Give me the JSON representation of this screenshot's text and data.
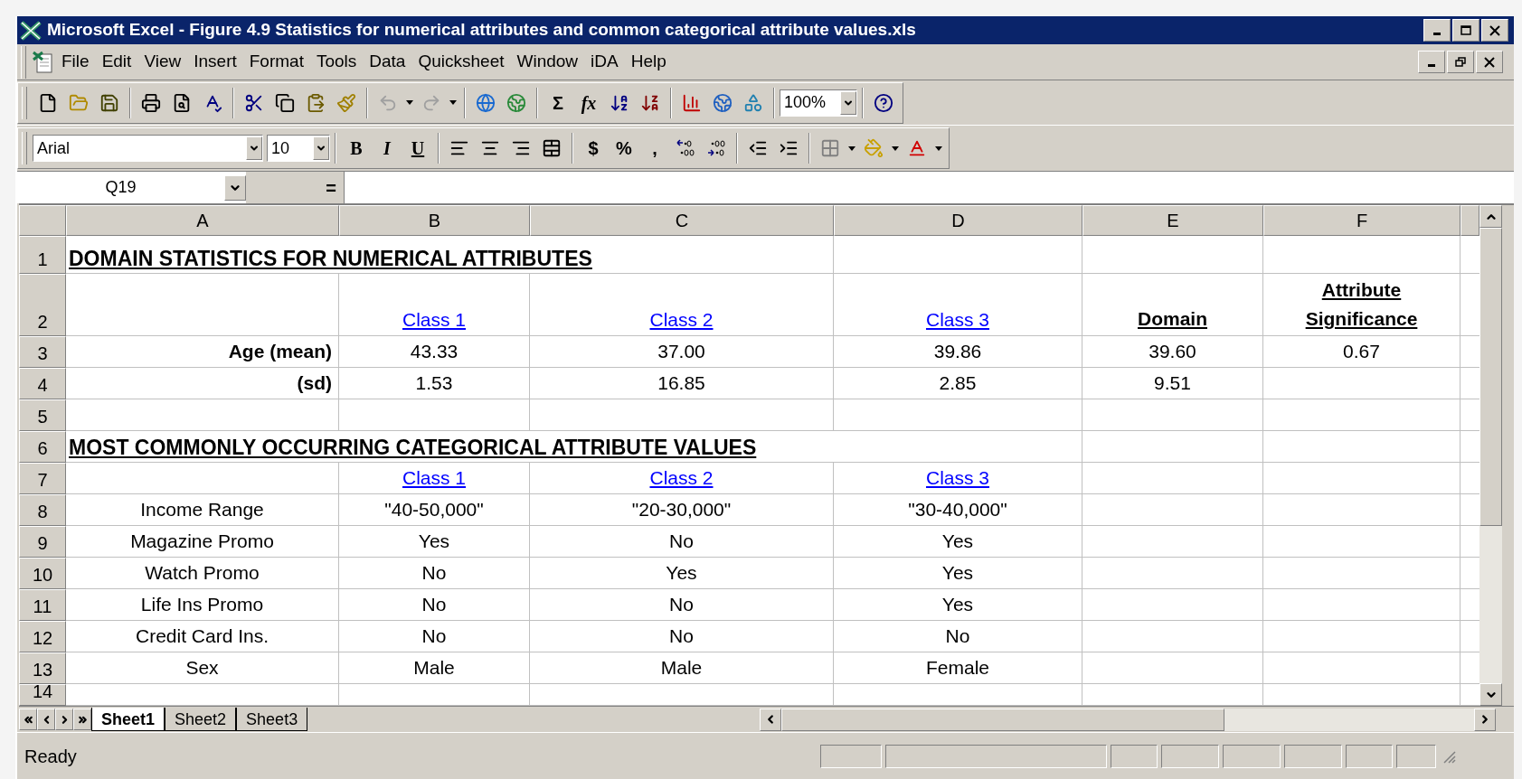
{
  "window": {
    "title": "Microsoft Excel - Figure 4.9 Statistics for numerical attributes and common categorical attribute values.xls"
  },
  "menu": [
    {
      "label": "File"
    },
    {
      "label": "Edit"
    },
    {
      "label": "View"
    },
    {
      "label": "Insert"
    },
    {
      "label": "Format"
    },
    {
      "label": "Tools"
    },
    {
      "label": "Data"
    },
    {
      "label": "Quicksheet"
    },
    {
      "label": "Window"
    },
    {
      "label": "iDA"
    },
    {
      "label": "Help"
    }
  ],
  "standard_toolbar": {
    "undo": {
      "disabled": true
    },
    "redo": {
      "disabled": true
    },
    "sum": "Σ",
    "function": "fx",
    "zoom": "100%"
  },
  "formatting_toolbar": {
    "font": "Arial",
    "size": "10",
    "bold": "B",
    "italic": "I",
    "underline": "U",
    "currency": "$",
    "percent": "%",
    "comma": ","
  },
  "formula_bar": {
    "name_box": "Q19",
    "equals": "="
  },
  "columns": [
    "A",
    "B",
    "C",
    "D",
    "E",
    "F"
  ],
  "rows": [
    {
      "number": "1",
      "cells": [
        {
          "kind": "heading",
          "text": "DOMAIN STATISTICS FOR NUMERICAL ATTRIBUTES"
        },
        {
          "kind": "blank"
        },
        {
          "kind": "blank"
        },
        {
          "kind": "blank"
        }
      ]
    },
    {
      "number": "2",
      "cells": [
        {
          "kind": "blank"
        },
        {
          "kind": "link",
          "text": "Class 1"
        },
        {
          "kind": "link",
          "text": "Class 2"
        },
        {
          "kind": "link",
          "text": "Class 3"
        },
        {
          "kind": "header",
          "text": "Domain"
        },
        {
          "kind": "header",
          "text": "Attribute Significance"
        }
      ]
    },
    {
      "number": "3",
      "cells": [
        {
          "kind": "label_right",
          "text": "Age (mean)"
        },
        {
          "kind": "value",
          "text": "43.33"
        },
        {
          "kind": "value",
          "text": "37.00"
        },
        {
          "kind": "value",
          "text": "39.86"
        },
        {
          "kind": "value",
          "text": "39.60"
        },
        {
          "kind": "value",
          "text": "0.67"
        }
      ]
    },
    {
      "number": "4",
      "cells": [
        {
          "kind": "label_right",
          "text": "(sd)"
        },
        {
          "kind": "value",
          "text": "1.53"
        },
        {
          "kind": "value",
          "text": "16.85"
        },
        {
          "kind": "value",
          "text": "2.85"
        },
        {
          "kind": "value",
          "text": "9.51"
        },
        {
          "kind": "blank"
        }
      ]
    },
    {
      "number": "5",
      "cells": [
        {
          "kind": "blank"
        },
        {
          "kind": "blank"
        },
        {
          "kind": "blank"
        },
        {
          "kind": "blank"
        },
        {
          "kind": "blank"
        },
        {
          "kind": "blank"
        }
      ]
    },
    {
      "number": "6",
      "cells": [
        {
          "kind": "heading",
          "text": "MOST COMMONLY OCCURRING CATEGORICAL ATTRIBUTE VALUES"
        },
        {
          "kind": "blank"
        },
        {
          "kind": "blank"
        }
      ]
    },
    {
      "number": "7",
      "cells": [
        {
          "kind": "blank"
        },
        {
          "kind": "link",
          "text": "Class 1"
        },
        {
          "kind": "link",
          "text": "Class 2"
        },
        {
          "kind": "link",
          "text": "Class 3"
        },
        {
          "kind": "blank"
        },
        {
          "kind": "blank"
        }
      ]
    },
    {
      "number": "8",
      "cells": [
        {
          "kind": "label",
          "text": "Income Range"
        },
        {
          "kind": "value",
          "text": "\"40-50,000\""
        },
        {
          "kind": "value",
          "text": "\"20-30,000\""
        },
        {
          "kind": "value",
          "text": "\"30-40,000\""
        },
        {
          "kind": "blank"
        },
        {
          "kind": "blank"
        }
      ]
    },
    {
      "number": "9",
      "cells": [
        {
          "kind": "label",
          "text": "Magazine Promo"
        },
        {
          "kind": "value",
          "text": "Yes"
        },
        {
          "kind": "value",
          "text": "No"
        },
        {
          "kind": "value",
          "text": "Yes"
        },
        {
          "kind": "blank"
        },
        {
          "kind": "blank"
        }
      ]
    },
    {
      "number": "10",
      "cells": [
        {
          "kind": "label",
          "text": "Watch Promo"
        },
        {
          "kind": "value",
          "text": "No"
        },
        {
          "kind": "value",
          "text": "Yes"
        },
        {
          "kind": "value",
          "text": "Yes"
        },
        {
          "kind": "blank"
        },
        {
          "kind": "blank"
        }
      ]
    },
    {
      "number": "11",
      "cells": [
        {
          "kind": "label",
          "text": "Life Ins Promo"
        },
        {
          "kind": "value",
          "text": "No"
        },
        {
          "kind": "value",
          "text": "No"
        },
        {
          "kind": "value",
          "text": "Yes"
        },
        {
          "kind": "blank"
        },
        {
          "kind": "blank"
        }
      ]
    },
    {
      "number": "12",
      "cells": [
        {
          "kind": "label",
          "text": "Credit Card Ins."
        },
        {
          "kind": "value",
          "text": "No"
        },
        {
          "kind": "value",
          "text": "No"
        },
        {
          "kind": "value",
          "text": "No"
        },
        {
          "kind": "blank"
        },
        {
          "kind": "blank"
        }
      ]
    },
    {
      "number": "13",
      "cells": [
        {
          "kind": "label",
          "text": "Sex"
        },
        {
          "kind": "value",
          "text": "Male"
        },
        {
          "kind": "value",
          "text": "Male"
        },
        {
          "kind": "value",
          "text": "Female"
        },
        {
          "kind": "blank"
        },
        {
          "kind": "blank"
        }
      ]
    },
    {
      "number": "14",
      "cells": [
        {
          "kind": "blank"
        },
        {
          "kind": "blank"
        },
        {
          "kind": "blank"
        },
        {
          "kind": "blank"
        },
        {
          "kind": "blank"
        },
        {
          "kind": "blank"
        }
      ]
    }
  ],
  "sheet_tabs": [
    {
      "label": "Sheet1",
      "selected": true
    },
    {
      "label": "Sheet2",
      "selected": false
    },
    {
      "label": "Sheet3",
      "selected": false
    }
  ],
  "status_bar": {
    "text": "Ready"
  }
}
